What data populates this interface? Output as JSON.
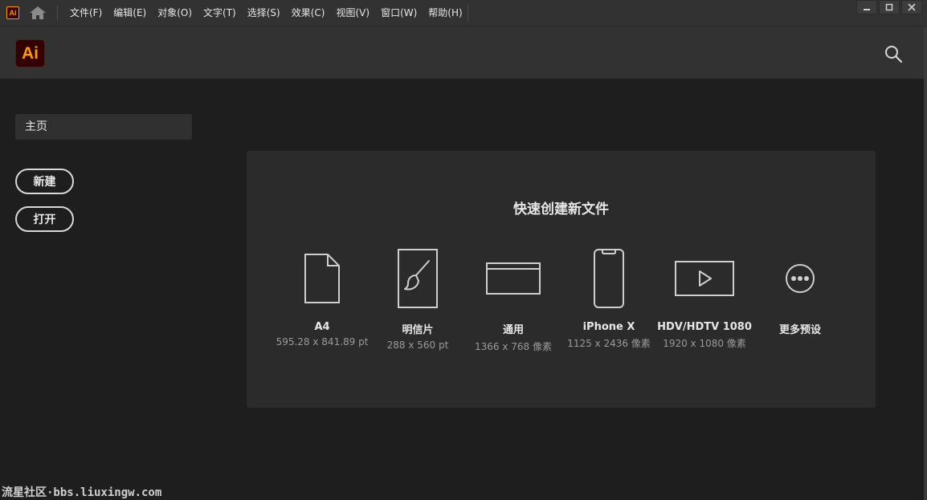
{
  "app": {
    "mini_logo": "Ai",
    "logo": "Ai",
    "accent": "#ff9a00",
    "logo_bg": "#330000"
  },
  "menu": [
    "文件(F)",
    "编辑(E)",
    "对象(O)",
    "文字(T)",
    "选择(S)",
    "效果(C)",
    "视图(V)",
    "窗口(W)",
    "帮助(H)"
  ],
  "sidebar": {
    "home": "主页",
    "new": "新建",
    "open": "打开"
  },
  "quick_start": {
    "title": "快速创建新文件",
    "presets": [
      {
        "name": "A4",
        "size": "595.28 x 841.89 pt",
        "icon": "document-icon"
      },
      {
        "name": "明信片",
        "size": "288 x 560 pt",
        "icon": "brush-icon"
      },
      {
        "name": "通用",
        "size": "1366 x 768 像素",
        "icon": "browser-window-icon"
      },
      {
        "name": "iPhone X",
        "size": "1125 x 2436 像素",
        "icon": "phone-icon"
      },
      {
        "name": "HDV/HDTV 1080",
        "size": "1920 x 1080 像素",
        "icon": "video-icon"
      },
      {
        "name": "更多预设",
        "size": "",
        "icon": "more-icon"
      }
    ]
  },
  "watermark": "流星社区·bbs.liuxingw.com"
}
